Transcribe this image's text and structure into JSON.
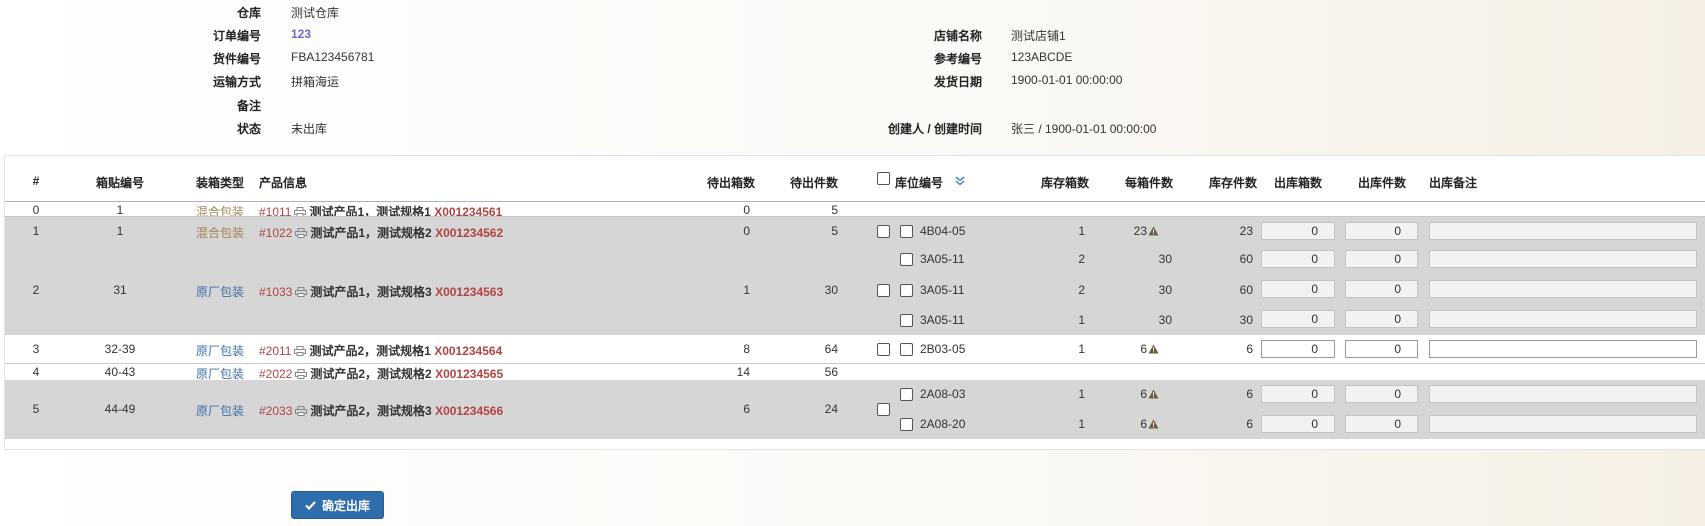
{
  "info": {
    "warehouse_label": "仓库",
    "warehouse": "测试仓库",
    "order_no_label": "订单编号",
    "order_no": "123",
    "shipment_no_label": "货件编号",
    "shipment_no": "FBA123456781",
    "transport_label": "运输方式",
    "transport": "拼箱海运",
    "remark_label": "备注",
    "remark": "",
    "status_label": "状态",
    "status": "未出库",
    "store_label": "店铺名称",
    "store": "测试店铺1",
    "ref_no_label": "参考编号",
    "ref_no": "123ABCDE",
    "ship_date_label": "发货日期",
    "ship_date": "1900-01-01 00:00:00",
    "creator_label": "创建人 / 创建时间",
    "creator": "张三 / 1900-01-01 00:00:00"
  },
  "table": {
    "headers": {
      "idx": "#",
      "box_no": "箱贴编号",
      "pack_type": "装箱类型",
      "product": "产品信息",
      "pending_boxes": "待出箱数",
      "pending_qty": "待出件数",
      "location": "库位编号",
      "stock_boxes": "库存箱数",
      "per_box": "每箱件数",
      "stock_qty": "库存件数",
      "out_boxes": "出库箱数",
      "out_qty": "出库件数",
      "out_remark": "出库备注"
    },
    "rows": [
      {
        "idx": "0",
        "box_no": "1",
        "pack": "混合包装",
        "code": "#1011",
        "name": "测试产品1，测试规格1",
        "sku": "X001234561",
        "pb": "0",
        "pq": "5"
      },
      {
        "idx": "1",
        "box_no": "1",
        "pack": "混合包装",
        "code": "#1022",
        "name": "测试产品1，测试规格2",
        "sku": "X001234562",
        "pb": "0",
        "pq": "5"
      },
      {
        "idx": "2",
        "box_no": "31",
        "pack": "原厂包装",
        "code": "#1033",
        "name": "测试产品1，测试规格3",
        "sku": "X001234563",
        "pb": "1",
        "pq": "30"
      },
      {
        "idx": "3",
        "box_no": "32-39",
        "pack": "原厂包装",
        "code": "#2011",
        "name": "测试产品2，测试规格1",
        "sku": "X001234564",
        "pb": "8",
        "pq": "64"
      },
      {
        "idx": "4",
        "box_no": "40-43",
        "pack": "原厂包装",
        "code": "#2022",
        "name": "测试产品2，测试规格2",
        "sku": "X001234565",
        "pb": "14",
        "pq": "56"
      },
      {
        "idx": "5",
        "box_no": "44-49",
        "pack": "原厂包装",
        "code": "#2033",
        "name": "测试产品2，测试规格3",
        "sku": "X001234566",
        "pb": "6",
        "pq": "24"
      }
    ],
    "locations": [
      {
        "loc": "4B04-05",
        "sb": "1",
        "per": "23",
        "sq": "23",
        "ob": "0",
        "oq": "0"
      },
      {
        "loc": "3A05-11",
        "sb": "2",
        "per": "30",
        "sq": "60",
        "ob": "0",
        "oq": "0"
      },
      {
        "loc": "3A05-11",
        "sb": "2",
        "per": "30",
        "sq": "60",
        "ob": "0",
        "oq": "0"
      },
      {
        "loc": "3A05-11",
        "sb": "1",
        "per": "30",
        "sq": "30",
        "ob": "0",
        "oq": "0"
      },
      {
        "loc": "2B03-05",
        "sb": "1",
        "per": "6",
        "sq": "6",
        "ob": "0",
        "oq": "0"
      },
      {
        "loc": "2A08-03",
        "sb": "1",
        "per": "6",
        "sq": "6",
        "ob": "0",
        "oq": "0"
      },
      {
        "loc": "2A08-20",
        "sb": "1",
        "per": "6",
        "sq": "6",
        "ob": "0",
        "oq": "0"
      }
    ]
  },
  "confirm_button": "确定出库"
}
